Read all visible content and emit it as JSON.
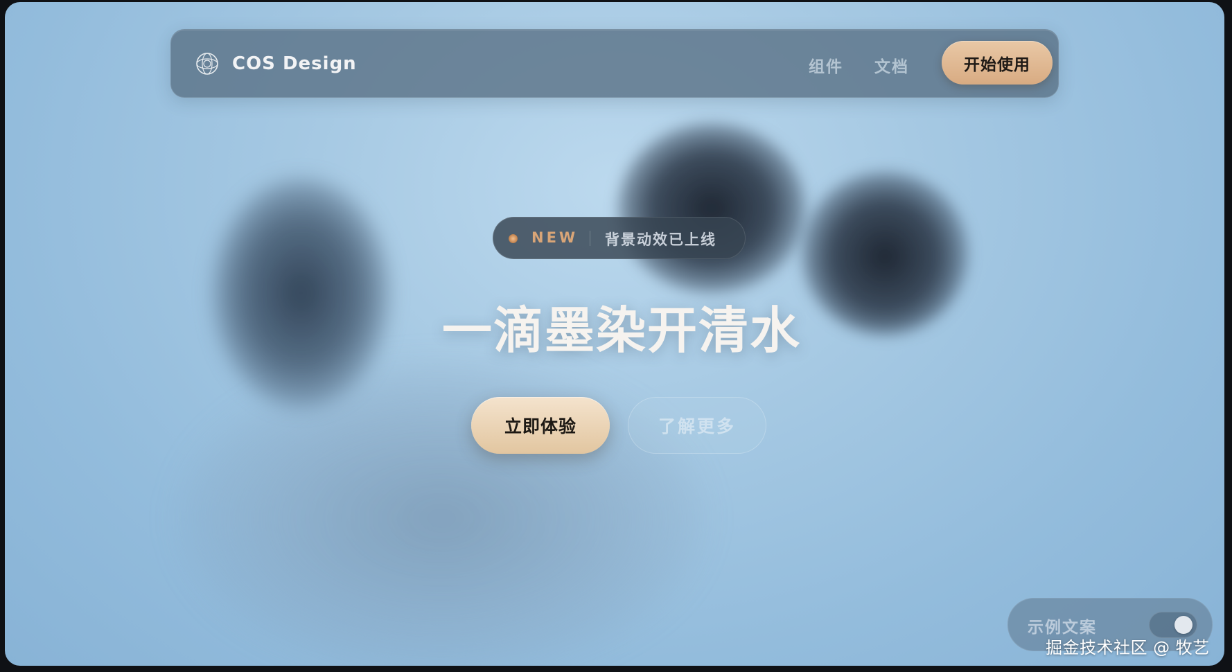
{
  "nav": {
    "brand_name": "COS Design",
    "brand_logo_icon": "cos-logo-icon",
    "links": [
      {
        "label": "组件"
      },
      {
        "label": "文档"
      }
    ],
    "cta_label": "开始使用"
  },
  "hero": {
    "badge": {
      "tag": "NEW",
      "text": "背景动效已上线"
    },
    "headline": "一滴墨染开清水",
    "primary_button": "立即体验",
    "secondary_button": "了解更多"
  },
  "demo_panel": {
    "label": "示例文案",
    "toggle_on": true
  },
  "watermark": "掘金技术社区 @ 牧艺",
  "colors": {
    "accent_gold": "#d8ab82",
    "primary_button_cream": "#f4e3cd",
    "background_blue": "#a6c9e3",
    "ink_dark": "#1c2430"
  }
}
